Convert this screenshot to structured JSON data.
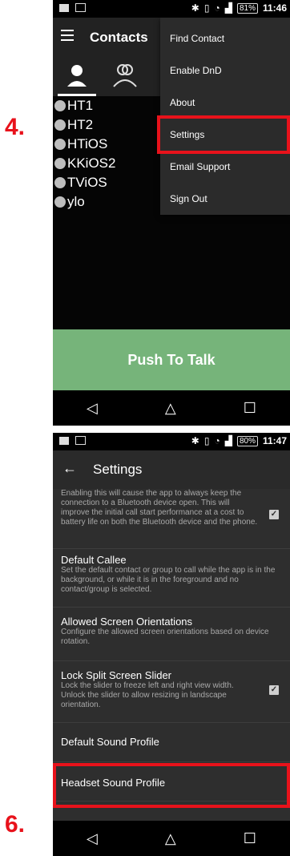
{
  "steps": {
    "step1": "4.",
    "step2": "6."
  },
  "screen1": {
    "status": {
      "battery": "81%",
      "time": "11:46"
    },
    "appbar": {
      "title": "Contacts"
    },
    "tabs": [
      {
        "icon": "person-icon"
      },
      {
        "icon": "group-icon"
      }
    ],
    "contacts": [
      "HT1",
      "HT2",
      "HTiOS",
      "KKiOS2",
      "TViOS",
      "ylo"
    ],
    "menu": [
      "Find Contact",
      "Enable DnD",
      "About",
      "Settings",
      "Email Support",
      "Sign Out"
    ],
    "ptt_label": "Push To Talk",
    "nav": {
      "back": "◁",
      "home": "△",
      "recents": "☐"
    }
  },
  "screen2": {
    "status": {
      "battery": "80%",
      "time": "11:47"
    },
    "appbar": {
      "title": "Settings"
    },
    "prefs": [
      {
        "title": "",
        "desc": "Enabling this will cause the app to always keep the connection to a Bluetooth device open. This will improve the initial call start performance at a cost to battery life on both the Bluetooth device and the phone.",
        "checked": true
      },
      {
        "title": "Default Callee",
        "desc": "Set the default contact or group to call while the app is in the background, or while it is in the foreground and no contact/group is selected."
      },
      {
        "title": "Allowed Screen Orientations",
        "desc": "Configure the allowed screen orientations based on device rotation."
      },
      {
        "title": "Lock Split Screen Slider",
        "desc": "Lock the slider to freeze left and right view width. Unlock the slider to allow resizing in landscape orientation.",
        "checked": true
      },
      {
        "title": "Default Sound Profile",
        "desc": ""
      },
      {
        "title": "Headset Sound Profile",
        "desc": ""
      }
    ],
    "nav": {
      "back": "◁",
      "home": "△",
      "recents": "☐"
    }
  },
  "colors": {
    "accent": "#e8121b",
    "ptt_green": "#76b47a"
  }
}
